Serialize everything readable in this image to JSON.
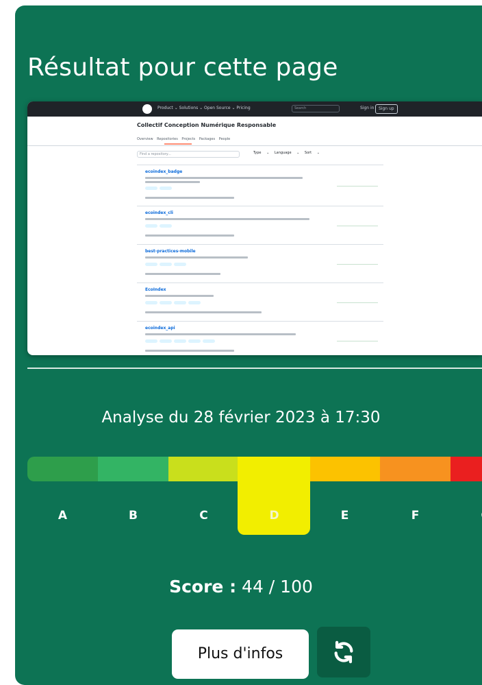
{
  "panel": {
    "title": "Résultat pour cette page"
  },
  "screenshot": {
    "nav": "Product ⌄   Solutions ⌄   Open Source ⌄   Pricing",
    "search_placeholder": "Search",
    "sign_in": "Sign in",
    "sign_up": "Sign up",
    "org_name": "Collectif Conception Numérique Responsable",
    "tabs": "Overview  Repositories  Projects  Packages  People",
    "find_placeholder": "Find a repository...",
    "filters": "Type ⌄  Language ⌄  Sort ⌄",
    "repos": [
      {
        "name": "ecoindex_badge"
      },
      {
        "name": "ecoindex_cli"
      },
      {
        "name": "best-practices-mobile"
      },
      {
        "name": "EcoIndex"
      },
      {
        "name": "ecoindex_api"
      }
    ]
  },
  "analysis": {
    "date_text": "Analyse du 28 février 2023 à 17:30"
  },
  "gauge": {
    "grades": [
      "A",
      "B",
      "C",
      "D",
      "E",
      "F",
      "G"
    ],
    "colors": [
      "#2e9e4b",
      "#33b464",
      "#c9df1c",
      "#f2ee00",
      "#fcc200",
      "#f7921f",
      "#ea1f1f"
    ],
    "current_grade": "D",
    "current_color": "#f2ee00"
  },
  "score": {
    "label": "Score :",
    "value": "44 / 100"
  },
  "buttons": {
    "more_info": "Plus d'infos",
    "refresh_icon": "refresh-icon"
  }
}
